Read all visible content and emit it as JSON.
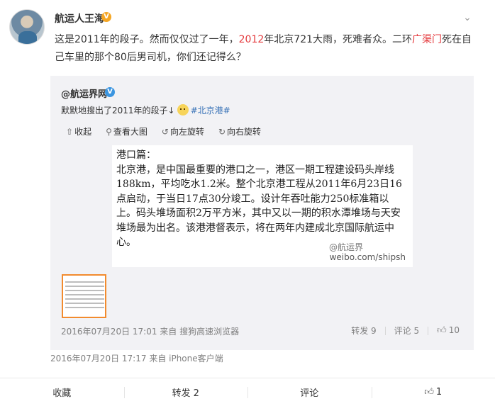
{
  "post": {
    "username": "航运人王海",
    "verified_badge": "V",
    "menu_icon": "chevron-down-icon",
    "text_segments": [
      {
        "text": "这是2011年的段子。然而仅仅过了一年，",
        "color": "#333333"
      },
      {
        "text": "2012",
        "color": "#e4393c"
      },
      {
        "text": "年北京721大雨，死难者众。二环",
        "color": "#333333"
      },
      {
        "text": "广渠门",
        "color": "#e4393c"
      },
      {
        "text": "死在自己车里的那个80后男司机，你们还记得么？",
        "color": "#333333"
      }
    ],
    "timestamp": "2016年07月20日 17:17",
    "source": "来自 iPhone客户端"
  },
  "repost": {
    "username": "@航运界网",
    "verified_badge": "V",
    "text": "默默地搜出了2011年的段子↓",
    "topic": "#北京港#",
    "toolbar": {
      "collapse": "收起",
      "view_large": "查看大图",
      "rotate_left": "向左旋转",
      "rotate_right": "向右旋转"
    },
    "image_text": {
      "line1": "港口篇：",
      "body": "北京港，是中国最重要的港口之一，港区一期工程建设码头岸线188km，平均吃水1.2米。整个北京港工程从2011年6月23日16点启动，于当日17点30分竣工。设计年吞吐能力250标准箱以上。码头堆场面积2万平方米，其中又以一期的积水潭堆场与天安堆场最为出名。该港港督表示，将在两年内建成北京国际航运中心。",
      "watermark_weibo": "@航运界",
      "watermark_url": "weibo.com/shipsh"
    },
    "meta": "2016年07月20日 17:01 来自 搜狗高速浏览器",
    "repost_label": "转发 9",
    "comment_label": "评论 5",
    "like_count": "10"
  },
  "footer": {
    "favorite": "收藏",
    "repost": "转发 2",
    "comment": "评论",
    "like_count": "1"
  },
  "colors": {
    "accent_red": "#e4393c",
    "topic_blue": "#3b74b8",
    "repost_bg": "#f2f2f5",
    "thumb_border": "#f28b2e",
    "verified_orange": "#f5a623",
    "verified_blue": "#3b95e0"
  }
}
